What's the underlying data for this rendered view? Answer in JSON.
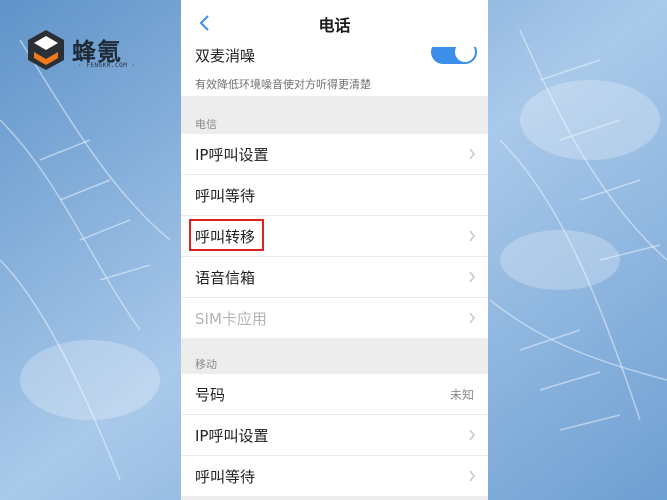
{
  "brand": {
    "name": "蜂氪",
    "sub": "· FENGKR.COM ·",
    "color_dark": "#2b2f36",
    "color_orange": "#f07a1a"
  },
  "header": {
    "title": "电话",
    "back_icon": "chevron-left-icon"
  },
  "dual_mic": {
    "label": "双麦消噪",
    "description": "有效降低环境噪音使对方听得更清楚",
    "enabled": true,
    "accent": "#3d8ee8"
  },
  "sections": [
    {
      "label": "电信",
      "items": [
        {
          "label": "IP呼叫设置",
          "chevron": true
        },
        {
          "label": "呼叫等待",
          "chevron": false
        },
        {
          "label": "呼叫转移",
          "chevron": true,
          "highlighted": true
        },
        {
          "label": "语音信箱",
          "chevron": true
        },
        {
          "label": "SIM卡应用",
          "chevron": true,
          "disabled": true
        }
      ]
    },
    {
      "label": "移动",
      "items": [
        {
          "label": "号码",
          "value": "未知",
          "chevron": false
        },
        {
          "label": "IP呼叫设置",
          "chevron": true
        },
        {
          "label": "呼叫等待",
          "chevron": true
        }
      ]
    }
  ],
  "highlight_color": "#e02020"
}
